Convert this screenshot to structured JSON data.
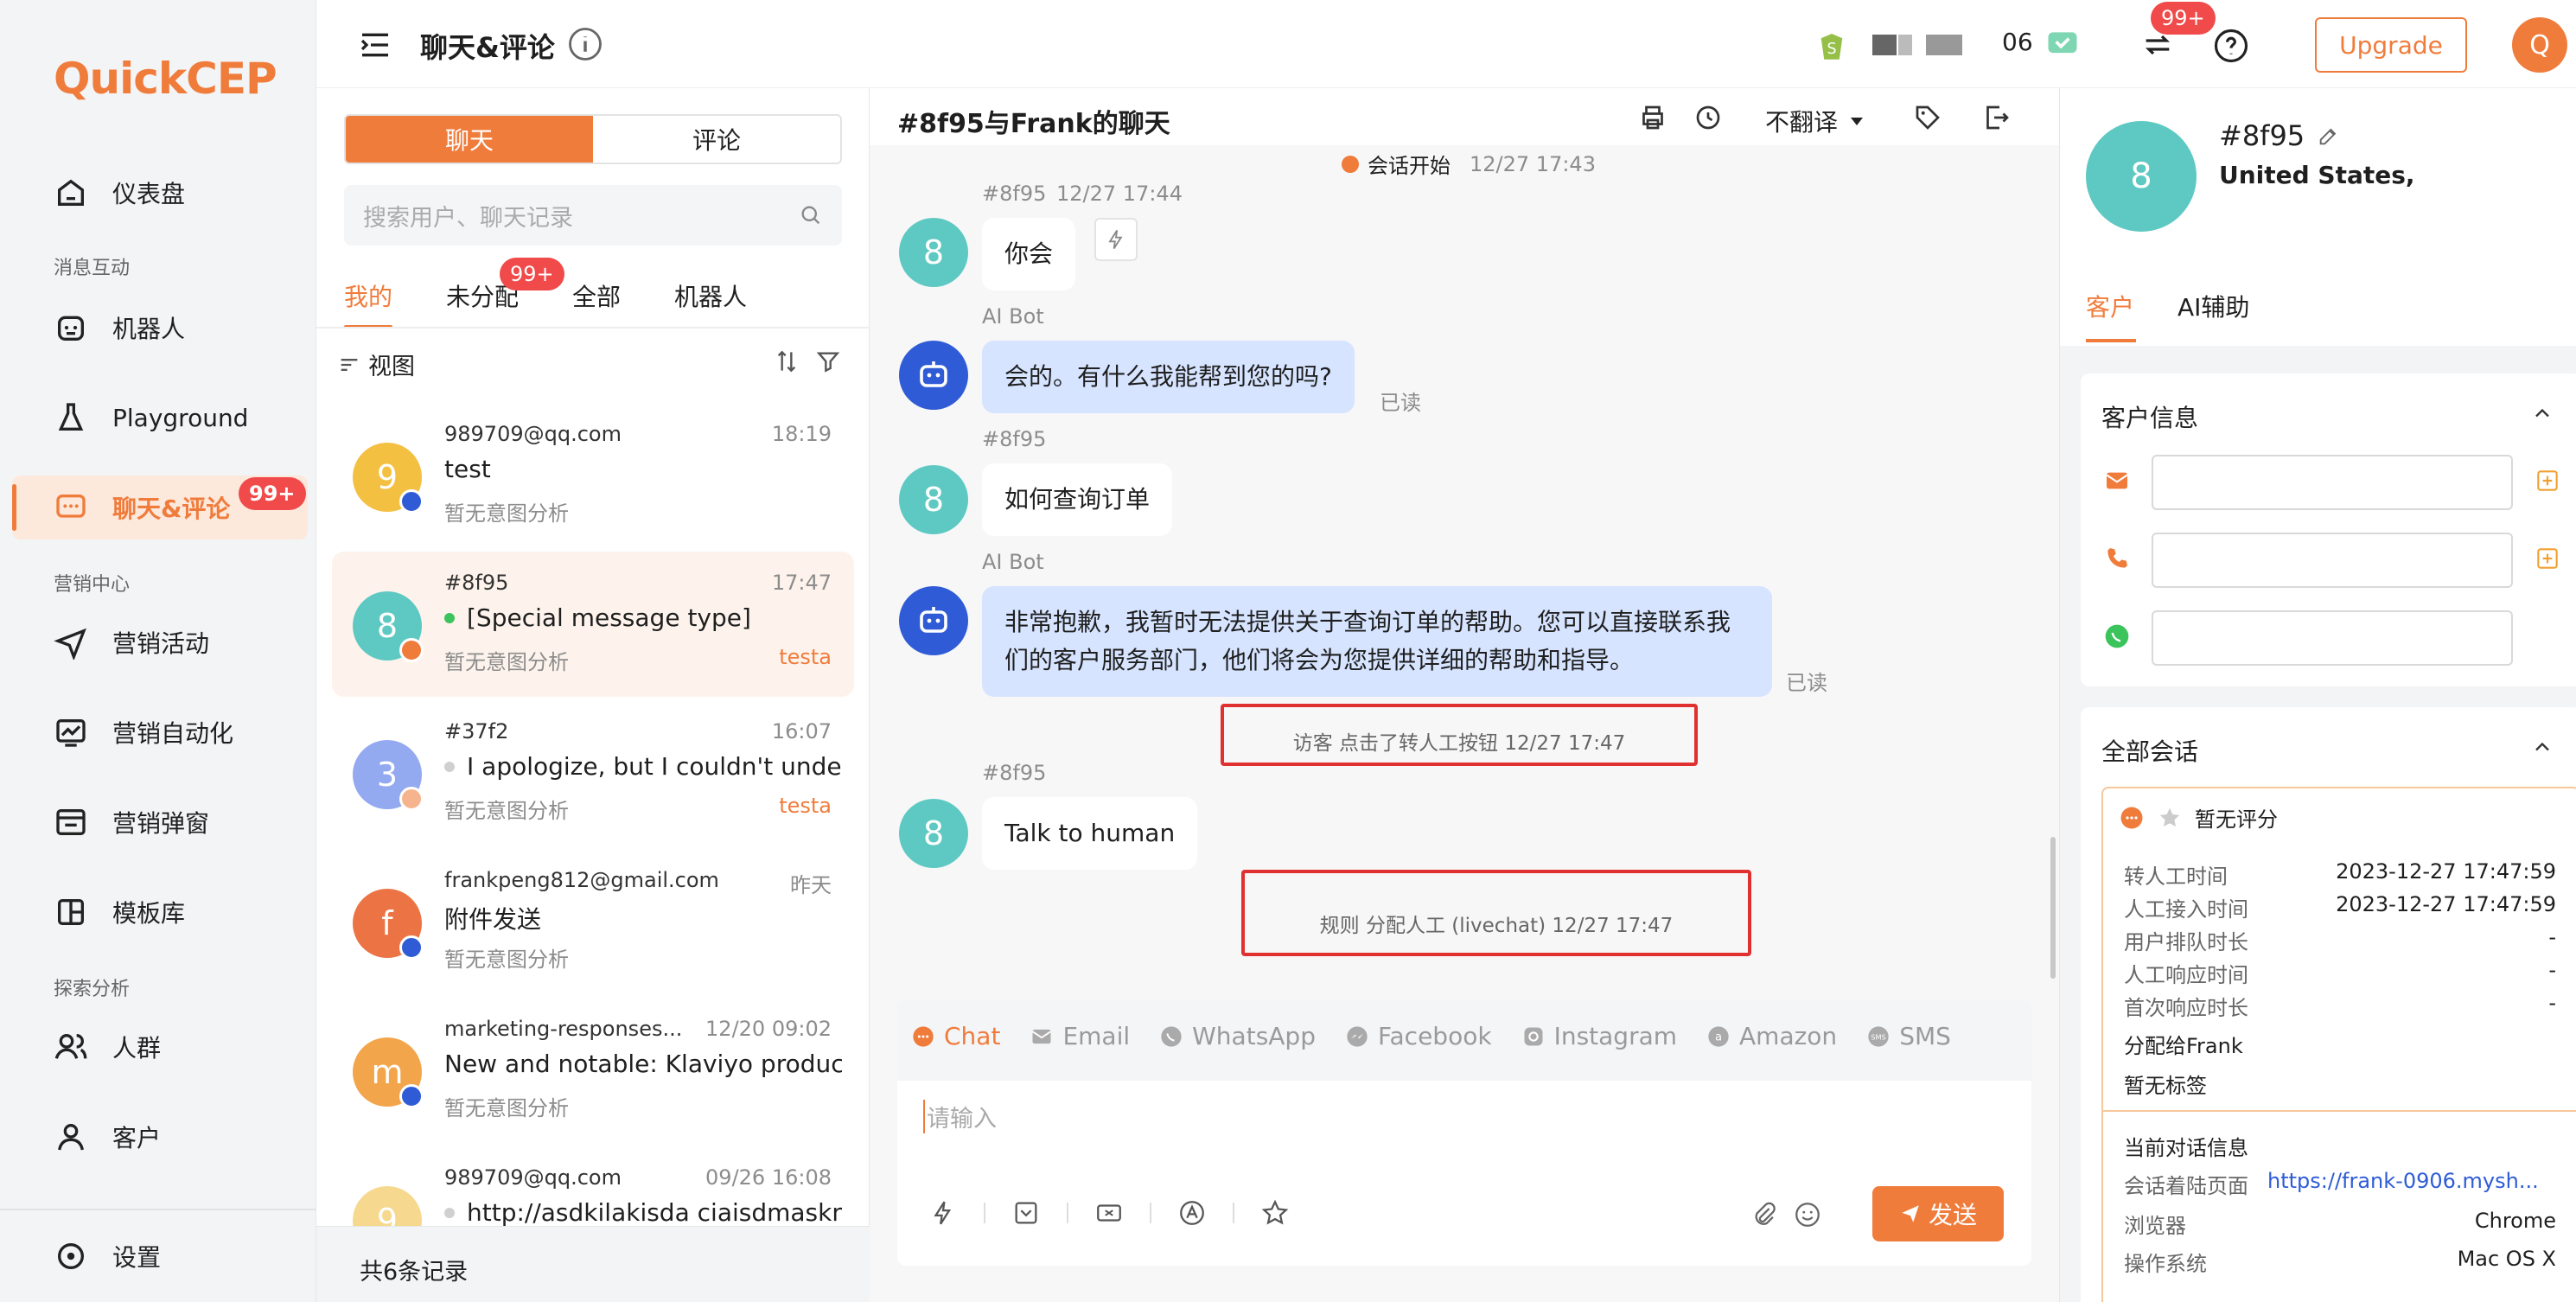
{
  "app": {
    "logo": "QuickCEP"
  },
  "sidebar": {
    "items": [
      {
        "label": "仪表盘",
        "icon": "home-icon"
      },
      {
        "label": "机器人",
        "icon": "robot-icon"
      },
      {
        "label": "Playground",
        "icon": "flask-icon"
      },
      {
        "label": "聊天&评论",
        "icon": "chat-icon",
        "badge": "99+"
      },
      {
        "label": "营销活动",
        "icon": "send-icon"
      },
      {
        "label": "营销自动化",
        "icon": "automation-icon"
      },
      {
        "label": "营销弹窗",
        "icon": "popup-icon"
      },
      {
        "label": "模板库",
        "icon": "template-icon"
      },
      {
        "label": "人群",
        "icon": "people-icon"
      },
      {
        "label": "客户",
        "icon": "user-icon"
      }
    ],
    "sections": [
      "消息互动",
      "营销中心",
      "探索分析"
    ],
    "settings": "设置"
  },
  "header": {
    "title": "聊天&评论",
    "notif_badge": "99+",
    "upgrade": "Upgrade",
    "user_initial": "Q",
    "count_fragment": "06"
  },
  "list": {
    "segments": [
      "聊天",
      "评论"
    ],
    "search_placeholder": "搜索用户、聊天记录",
    "tabs": [
      "我的",
      "未分配",
      "全部",
      "机器人"
    ],
    "unassigned_badge": "99+",
    "view_label": "视图",
    "footer": "共6条记录",
    "items": [
      {
        "name": "989709@qq.com",
        "time": "18:19",
        "message": "test",
        "sub": "暂无意图分析",
        "initial": "9",
        "color": "#f4c042",
        "tag": ""
      },
      {
        "name": "#8f95",
        "time": "17:47",
        "message": "[Special message type]",
        "sub": "暂无意图分析",
        "initial": "8",
        "color": "#5ec9c2",
        "tag": "testa"
      },
      {
        "name": "#37f2",
        "time": "16:07",
        "message": "I apologize, but I couldn't under",
        "sub": "暂无意图分析",
        "initial": "3",
        "color": "#93a9f0",
        "tag": "testa"
      },
      {
        "name": "frankpeng812@gmail.com",
        "time": "昨天",
        "message": "附件发送",
        "sub": "暂无意图分析",
        "initial": "f",
        "color": "#ec7344",
        "tag": ""
      },
      {
        "name": "marketing-responses...",
        "time": "12/20 09:02",
        "message": "New and notable: Klaviyo product",
        "sub": "暂无意图分析",
        "initial": "m",
        "color": "#f2a54a",
        "tag": ""
      },
      {
        "name": "989709@qq.com",
        "time": "09/26 16:08",
        "message": "http://asdkilakisda ciaisdmaskn",
        "sub": "",
        "initial": "9",
        "color": "#f6d88e",
        "tag": ""
      }
    ]
  },
  "chat": {
    "title": "#8f95与Frank的聊天",
    "translate": "不翻译",
    "session_start": "会话开始",
    "session_time": "12/27 17:43",
    "messages": [
      {
        "sender": "#8f95",
        "time": "12/27 17:44",
        "text": "你会"
      },
      {
        "sender": "AI Bot",
        "text": "会的。有什么我能帮到您的吗?",
        "read": "已读"
      },
      {
        "sender": "#8f95",
        "text": "如何查询订单"
      },
      {
        "sender": "AI Bot",
        "text_line1": "非常抱歉，我暂时无法提供关于查询订单的帮助。您可以直接联系我",
        "text_line2": "们的客户服务部门，他们将会为您提供详细的帮助和指导。",
        "read": "已读"
      },
      {
        "sender": "#8f95",
        "text": "Talk to human"
      }
    ],
    "system1": "访客 点击了转人工按钮   12/27 17:47",
    "system2": "规则 分配人工 (livechat)   12/27 17:47",
    "channels": [
      "Chat",
      "Email",
      "WhatsApp",
      "Facebook",
      "Instagram",
      "Amazon",
      "SMS"
    ],
    "input_placeholder": "请输入",
    "send": "发送"
  },
  "right": {
    "initial": "8",
    "name": "#8f95",
    "location": "United States,",
    "tabs": [
      "客户",
      "AI辅助"
    ],
    "customer_info": "客户信息",
    "all_sessions": "全部会话",
    "rating": "暂无评分",
    "rows": [
      {
        "k": "转人工时间",
        "v": "2023-12-27 17:47:59"
      },
      {
        "k": "人工接入时间",
        "v": "2023-12-27 17:47:59"
      },
      {
        "k": "用户排队时长",
        "v": "-"
      },
      {
        "k": "人工响应时间",
        "v": "-"
      },
      {
        "k": "首次响应时长",
        "v": "-"
      }
    ],
    "assigned": "分配给Frank",
    "tags": "暂无标签",
    "current_info": "当前对话信息",
    "landing_label": "会话着陆页面",
    "landing_value": "https://frank-0906.mysh...",
    "browser_label": "浏览器",
    "browser_value": "Chrome",
    "os_label": "操作系统",
    "os_value": "Mac OS X"
  },
  "colors": {
    "accent": "#f07c3c",
    "bot_bubble": "#d6e4ff",
    "highlight_red": "#e03030"
  }
}
